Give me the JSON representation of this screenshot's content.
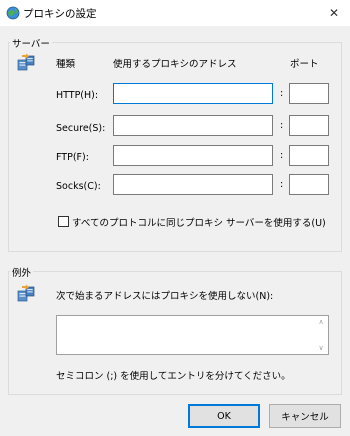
{
  "window": {
    "title": "プロキシの設定",
    "close_glyph": "✕"
  },
  "servers": {
    "group_label": "サーバー",
    "type_header": "種類",
    "address_header": "使用するプロキシのアドレス",
    "port_header": "ポート",
    "rows": [
      {
        "label": "HTTP(H):",
        "address": "",
        "port": ""
      },
      {
        "label": "Secure(S):",
        "address": "",
        "port": ""
      },
      {
        "label": "FTP(F):",
        "address": "",
        "port": ""
      },
      {
        "label": "Socks(C):",
        "address": "",
        "port": ""
      }
    ],
    "colon": ":",
    "same_proxy_label": "すべてのプロトコルに同じプロキシ サーバーを使用する(U)",
    "same_proxy_checked": false
  },
  "exceptions": {
    "group_label": "例外",
    "description": "次で始まるアドレスにはプロキシを使用しない(N):",
    "value": "",
    "hint": "セミコロン (;) を使用してエントリを分けてください。",
    "scroll_up": "∧",
    "scroll_down": "∨"
  },
  "buttons": {
    "ok": "OK",
    "cancel": "キャンセル"
  }
}
